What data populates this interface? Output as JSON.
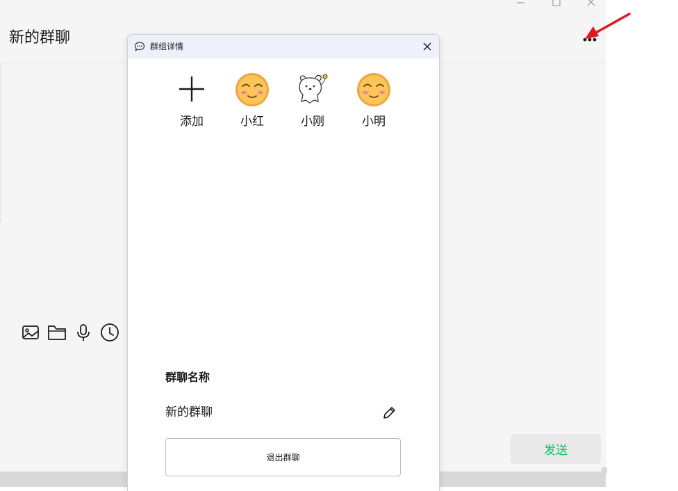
{
  "chat": {
    "title": "新的群聊",
    "send_label": "发送"
  },
  "toolbar": {
    "tools": [
      "image-icon",
      "folder-icon",
      "microphone-icon",
      "clock-icon"
    ]
  },
  "window_controls": [
    "minimize-icon",
    "maximize-icon",
    "close-icon"
  ],
  "dialog": {
    "title": "群组详情",
    "members": [
      {
        "name": "添加",
        "icon": "plus-icon"
      },
      {
        "name": "小红",
        "icon": "smiley-avatar"
      },
      {
        "name": "小刚",
        "icon": "bear-avatar"
      },
      {
        "name": "小明",
        "icon": "smiley-avatar"
      }
    ],
    "group_name_label": "群聊名称",
    "group_name_value": "新的群聊",
    "exit_label": "退出群聊"
  },
  "colors": {
    "accent_green": "#07c160",
    "annotation_red": "#e8141b",
    "dialog_titlebar": "#eef1f9",
    "chat_background": "#f5f5f5"
  }
}
